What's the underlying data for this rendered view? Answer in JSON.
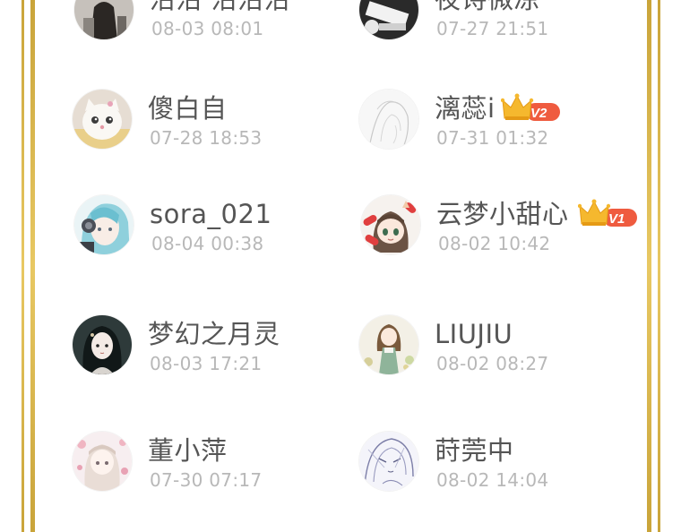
{
  "users": [
    {
      "name": "沿沿 沿沿沿",
      "time": "08-03 08:01",
      "avatar_icon": "avatar-dark-girl-icon"
    },
    {
      "name": "夜诗微凉",
      "time": "07-27 21:51",
      "avatar_icon": "avatar-black-white-icon"
    },
    {
      "name": "傻白自",
      "time": "07-28 18:53",
      "avatar_icon": "avatar-white-cat-icon"
    },
    {
      "name": "漓蕊i",
      "time": "07-31 01:32",
      "avatar_icon": "avatar-sketch-icon",
      "vip": "V2"
    },
    {
      "name": "sora_021",
      "time": "08-04 00:38",
      "avatar_icon": "avatar-headphone-girl-icon"
    },
    {
      "name": "云梦小甜心",
      "time": "08-02 10:42",
      "avatar_icon": "avatar-chibi-girl-icon",
      "vip": "V1"
    },
    {
      "name": "梦幻之月灵",
      "time": "08-03 17:21",
      "avatar_icon": "avatar-anime-girl-dark-icon"
    },
    {
      "name": "LIUJIU",
      "time": "08-02 08:27",
      "avatar_icon": "avatar-green-dress-girl-icon"
    },
    {
      "name": "董小萍",
      "time": "07-30 07:17",
      "avatar_icon": "avatar-pink-girl-icon"
    },
    {
      "name": "莳莞中",
      "time": "08-02 14:04",
      "avatar_icon": "avatar-lineart-girl-icon"
    }
  ],
  "colors": {
    "frame_gold": "#c9a43a",
    "name_text": "#555555",
    "time_text": "#b8b8b8",
    "vip_crown": "#f5b82e",
    "vip_tag": "#ef5b3f"
  }
}
